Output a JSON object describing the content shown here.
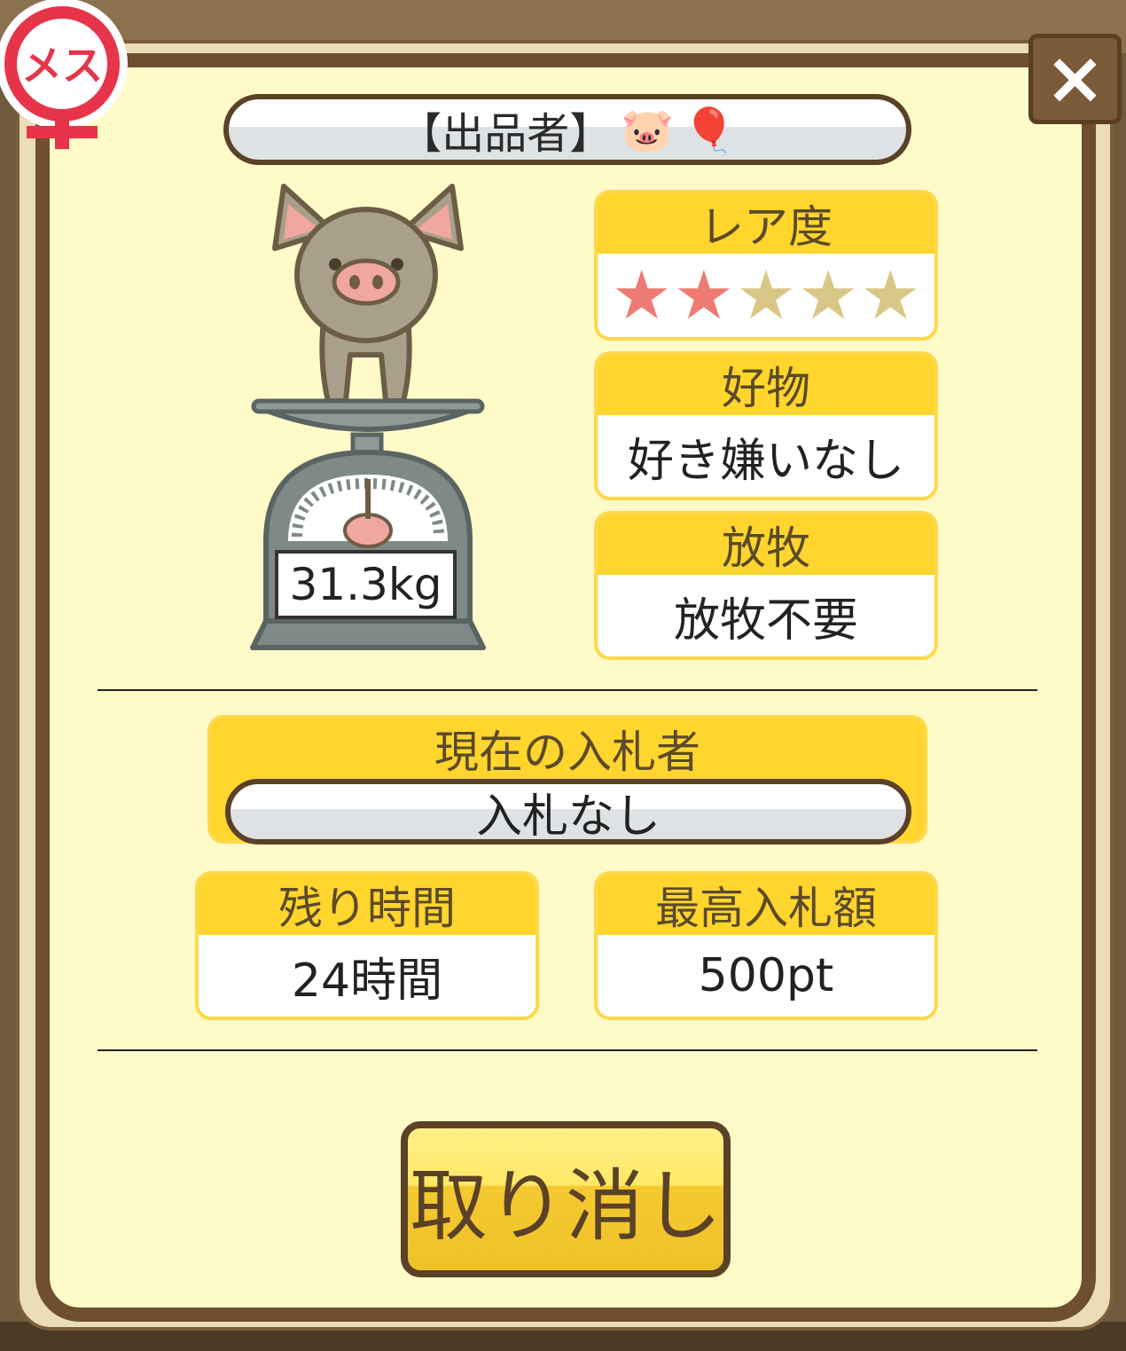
{
  "gender_badge": {
    "label": "メス",
    "icon": "female-symbol-icon"
  },
  "close_button": {
    "label": "×",
    "icon": "close-icon"
  },
  "seller": {
    "label": "【出品者】",
    "emoji_pig": "🐷",
    "emoji_balloon": "🎈"
  },
  "weight": {
    "value": "31.3kg"
  },
  "rarity": {
    "label": "レア度",
    "stars_total": 5,
    "stars_filled": 2
  },
  "favorite": {
    "label": "好物",
    "value": "好き嫌いなし"
  },
  "grazing": {
    "label": "放牧",
    "value": "放牧不要"
  },
  "current_bidder": {
    "label": "現在の入札者",
    "value": "入札なし"
  },
  "time_left": {
    "label": "残り時間",
    "value": "24時間"
  },
  "max_bid": {
    "label": "最高入札額",
    "value": "500pt"
  },
  "cancel_button": {
    "label": "取り消し"
  },
  "colors": {
    "panel_bg": "#fffbc8",
    "panel_border": "#6f4f2f",
    "card_header": "#ffd52e",
    "star_on": "#ee7b73",
    "star_off": "#d9c788",
    "badge_red": "#e8344a"
  }
}
